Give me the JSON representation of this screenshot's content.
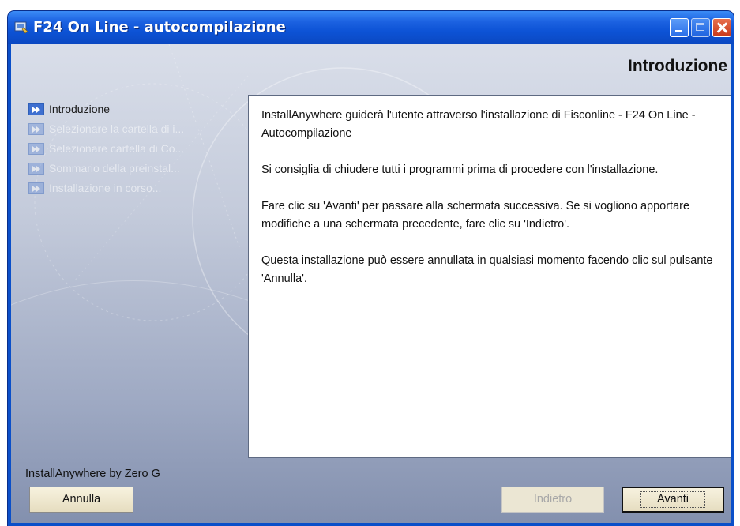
{
  "window": {
    "title": "F24 On Line - autocompilazione",
    "icon": "installer-window-icon",
    "controls": [
      "minimize-icon",
      "maximize-icon",
      "close-icon"
    ]
  },
  "panel": {
    "title": "Introduzione"
  },
  "steps": [
    {
      "label": "Introduzione",
      "state": "active"
    },
    {
      "label": "Selezionare la cartella di i...",
      "state": "pending"
    },
    {
      "label": "Selezionare cartella di Co...",
      "state": "pending"
    },
    {
      "label": "Sommario della preinstal...",
      "state": "pending"
    },
    {
      "label": "Installazione in corso...",
      "state": "pending"
    }
  ],
  "content": {
    "paragraphs": [
      "InstallAnywhere guiderà l'utente attraverso l'installazione di Fisconline - F24 On Line - Autocompilazione",
      "Si consiglia di chiudere tutti i programmi prima di procedere con l'installazione.",
      "Fare clic su 'Avanti' per passare alla schermata successiva. Se si vogliono apportare modifiche a una schermata precedente, fare clic su 'Indietro'.",
      "Questa installazione può essere annullata in qualsiasi momento facendo clic sul pulsante 'Annulla'."
    ]
  },
  "footer": {
    "brand": "InstallAnywhere by Zero G",
    "buttons": {
      "cancel": "Annulla",
      "back": "Indietro",
      "next": "Avanti"
    }
  },
  "colors": {
    "titlebar": "#0d53d6",
    "accent": "#3e6fd0"
  }
}
